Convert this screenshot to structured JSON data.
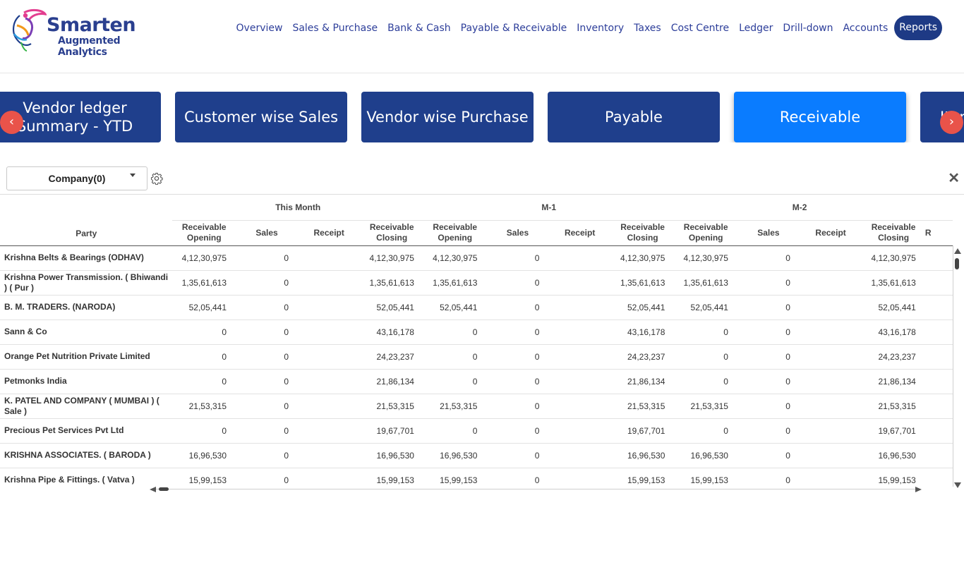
{
  "brand": {
    "name": "Smarten",
    "tagline": "Augmented Analytics",
    "colors": {
      "navy": "#1f3f8c",
      "accent": "#0a7cff",
      "arrow": "#e9534a"
    }
  },
  "nav": {
    "items": [
      "Overview",
      "Sales & Purchase",
      "Bank & Cash",
      "Payable & Receivable",
      "Inventory",
      "Taxes",
      "Cost Centre",
      "Ledger",
      "Drill-down",
      "Accounts"
    ],
    "active": "Reports"
  },
  "tiles": [
    {
      "label": "Vendor ledger Summary - YTD"
    },
    {
      "label": "Customer wise Sales"
    },
    {
      "label": "Vendor wise Purchase"
    },
    {
      "label": "Payable"
    },
    {
      "label": "Receivable",
      "active": true
    },
    {
      "label": "Item"
    }
  ],
  "arrows": {
    "prev": "‹",
    "next": "›"
  },
  "filters": {
    "company": "Company(0)"
  },
  "close_label": "✕",
  "table": {
    "party_header": "Party",
    "groups": [
      "This Month",
      "M-1",
      "M-2"
    ],
    "sub_headers": [
      "Receivable Opening",
      "Sales",
      "Receipt",
      "Receivable Closing"
    ],
    "trailing_header": "R",
    "rows": [
      {
        "party": "Krishna Belts & Bearings (ODHAV)",
        "cells": [
          "4,12,30,975",
          "0",
          "",
          "4,12,30,975",
          "4,12,30,975",
          "0",
          "",
          "4,12,30,975",
          "4,12,30,975",
          "0",
          "",
          "4,12,30,975"
        ]
      },
      {
        "party": "Krishna Power Transmission. ( Bhiwandi ) ( Pur )",
        "cells": [
          "1,35,61,613",
          "0",
          "",
          "1,35,61,613",
          "1,35,61,613",
          "0",
          "",
          "1,35,61,613",
          "1,35,61,613",
          "0",
          "",
          "1,35,61,613"
        ]
      },
      {
        "party": "B. M. TRADERS. (NARODA)",
        "cells": [
          "52,05,441",
          "0",
          "",
          "52,05,441",
          "52,05,441",
          "0",
          "",
          "52,05,441",
          "52,05,441",
          "0",
          "",
          "52,05,441"
        ]
      },
      {
        "party": "Sann & Co",
        "cells": [
          "0",
          "0",
          "",
          "43,16,178",
          "0",
          "0",
          "",
          "43,16,178",
          "0",
          "0",
          "",
          "43,16,178"
        ]
      },
      {
        "party": "Orange Pet Nutrition Private Limited",
        "cells": [
          "0",
          "0",
          "",
          "24,23,237",
          "0",
          "0",
          "",
          "24,23,237",
          "0",
          "0",
          "",
          "24,23,237"
        ]
      },
      {
        "party": "Petmonks India",
        "cells": [
          "0",
          "0",
          "",
          "21,86,134",
          "0",
          "0",
          "",
          "21,86,134",
          "0",
          "0",
          "",
          "21,86,134"
        ]
      },
      {
        "party": "K. PATEL AND COMPANY ( MUMBAI ) ( Sale )",
        "cells": [
          "21,53,315",
          "0",
          "",
          "21,53,315",
          "21,53,315",
          "0",
          "",
          "21,53,315",
          "21,53,315",
          "0",
          "",
          "21,53,315"
        ]
      },
      {
        "party": "Precious Pet Services Pvt Ltd",
        "cells": [
          "0",
          "0",
          "",
          "19,67,701",
          "0",
          "0",
          "",
          "19,67,701",
          "0",
          "0",
          "",
          "19,67,701"
        ]
      },
      {
        "party": "KRISHNA ASSOCIATES. ( BARODA )",
        "cells": [
          "16,96,530",
          "0",
          "",
          "16,96,530",
          "16,96,530",
          "0",
          "",
          "16,96,530",
          "16,96,530",
          "0",
          "",
          "16,96,530"
        ]
      },
      {
        "party": "Krishna Pipe & Fittings. ( Vatva )",
        "cells": [
          "15,99,153",
          "0",
          "",
          "15,99,153",
          "15,99,153",
          "0",
          "",
          "15,99,153",
          "15,99,153",
          "0",
          "",
          "15,99,153"
        ]
      }
    ]
  }
}
